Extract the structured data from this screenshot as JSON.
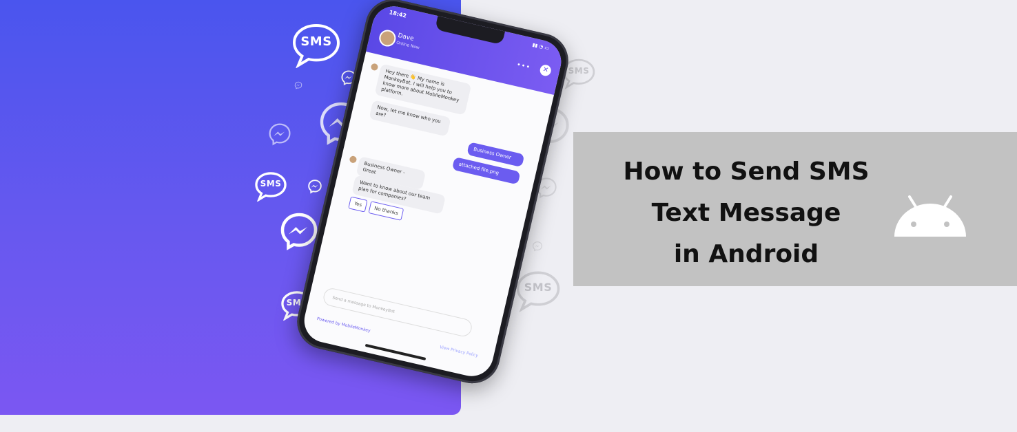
{
  "banner": {
    "title_lines": [
      "How to Send SMS",
      "Text Message",
      "in Android"
    ]
  },
  "sms_label": "SMS",
  "icons": {
    "messenger": "messenger-icon",
    "sms": "sms-bubble-icon",
    "android": "android-icon"
  },
  "phone": {
    "status_time": "18:42",
    "status_icons": "▮▮ ◔ ▭",
    "agent_name": "Dave",
    "agent_status": "Online Now",
    "header_dots": "•••",
    "close_symbol": "✕",
    "messages": [
      {
        "from": "bot",
        "text": "Hey there 👋 My name is MonkeyBot. I will help you to know more about MobileMonkey platform."
      },
      {
        "from": "bot",
        "text": "Now, let me know who you are?"
      },
      {
        "from": "user",
        "text": "Business Owner"
      },
      {
        "from": "user",
        "text": "attached file.png"
      },
      {
        "from": "bot",
        "text": "Business Owner - Great"
      },
      {
        "from": "bot",
        "text": "Want to know about our team plan for companies?"
      }
    ],
    "options": [
      "Yes",
      "No thanks"
    ],
    "input_placeholder": "Send a message to MonkeyBot",
    "powered_by": "Powered by MobileMonkey",
    "privacy": "View Privacy Policy"
  },
  "colors": {
    "panel_gradient_top": "#4a55ee",
    "panel_gradient_bottom": "#7b57f2",
    "page_background": "#eeeef3",
    "title_band": "#c2c2c2",
    "android_icon": "#ffffff"
  }
}
